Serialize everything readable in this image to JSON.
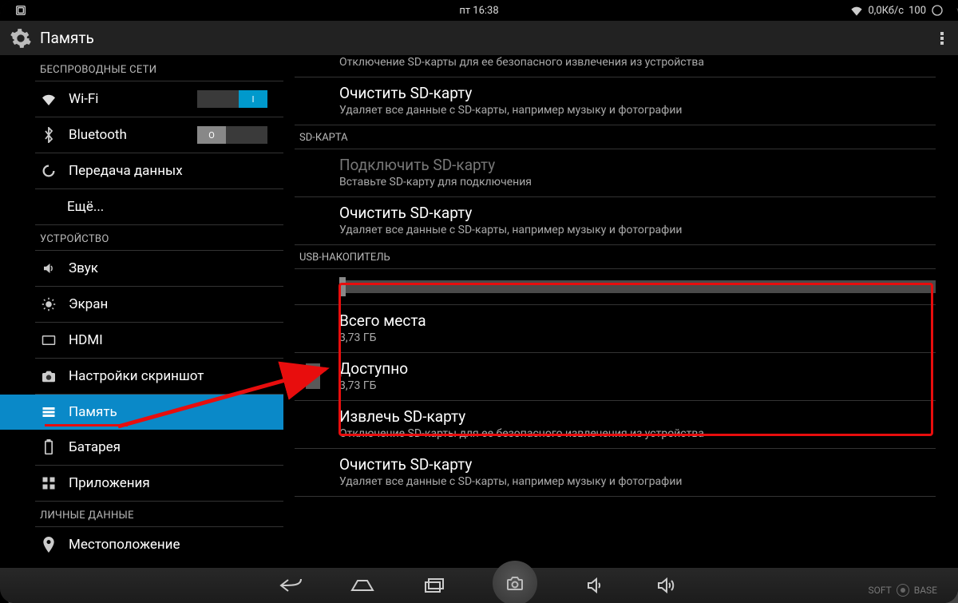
{
  "statusbar": {
    "time": "пт 16:38",
    "data_rate": "0,0Кб/с",
    "battery": "100"
  },
  "actionbar": {
    "title": "Память"
  },
  "sidebar": {
    "wireless_header": "БЕСПРОВОДНЫЕ СЕТИ",
    "wifi": "Wi-Fi",
    "wifi_toggle_on": "I",
    "bluetooth": "Bluetooth",
    "bt_toggle_off": "O",
    "data_usage": "Передача данных",
    "more": "Ещё...",
    "device_header": "УСТРОЙСТВО",
    "sound": "Звук",
    "display": "Экран",
    "hdmi": "HDMI",
    "screenshot": "Настройки скриншот",
    "storage": "Память",
    "battery": "Батарея",
    "apps": "Приложения",
    "personal_header": "ЛИЧНЫЕ ДАННЫЕ",
    "location": "Местоположение"
  },
  "content": {
    "eject_sd_title_cut": "Извлечь SD-карту",
    "eject_sd_sub": "Отключение SD-карты для ее безопасного извлечения из устройства",
    "erase_sd_title": "Очистить SD-карту",
    "erase_sd_sub": "Удаляет все данные с SD-карты, например музыку и фотографии",
    "sd_card_header": "SD-КАРТА",
    "mount_sd_title": "Подключить SD-карту",
    "mount_sd_sub": "Вставьте SD-карту для подключения",
    "erase_sd2_title": "Очистить SD-карту",
    "erase_sd2_sub": "Удаляет все данные с SD-карты, например музыку и фотографии",
    "usb_header": "USB-НАКОПИТЕЛЬ",
    "total_title": "Всего места",
    "total_val": "3,73 ГБ",
    "avail_title": "Доступно",
    "avail_val": "3,73 ГБ",
    "eject_usb_title": "Извлечь SD-карту",
    "eject_usb_sub": "Отключение SD-карты для ее безопасного извлечения из устройства",
    "erase_usb_title": "Очистить SD-карту",
    "erase_usb_sub": "Удаляет все данные с SD-карты, например музыку и фотографии"
  },
  "watermark": {
    "left": "SOFT",
    "right": "BASE"
  }
}
